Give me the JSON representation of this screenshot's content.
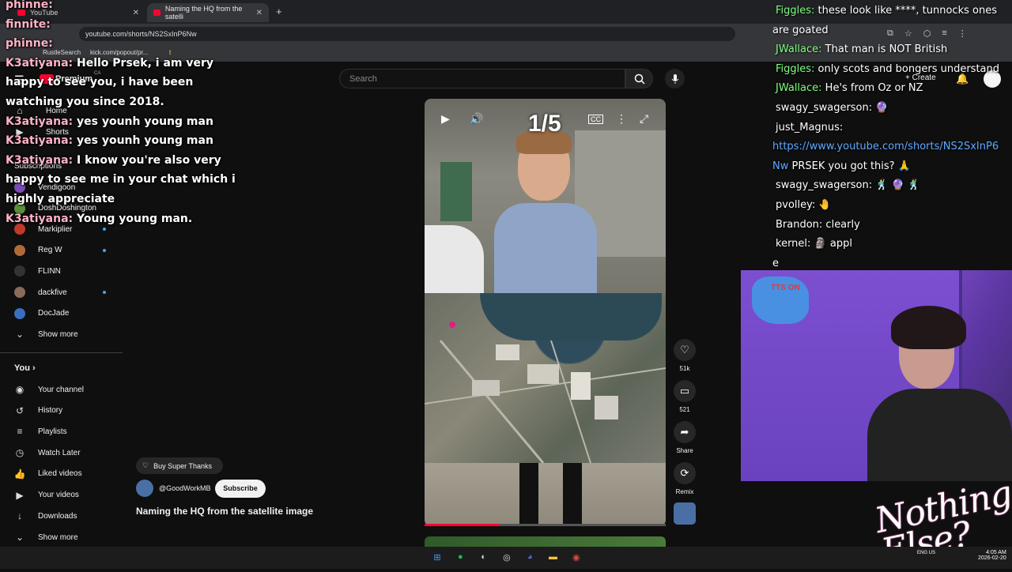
{
  "browser": {
    "tabs": [
      {
        "label": "YouTube"
      },
      {
        "label": "Naming the HQ from the satelli"
      }
    ],
    "new_tab": "+",
    "url": "youtube.com/shorts/NS2SxInP6Nw",
    "bookmarks": [
      "RustleSearch",
      "kick.com/popout/pr...",
      "t"
    ]
  },
  "youtube": {
    "logo": "Premium",
    "region": "CA",
    "search_placeholder": "Search",
    "create_label": "Create",
    "sidebar": {
      "items": [
        {
          "label": "Home",
          "icon": "home-icon"
        },
        {
          "label": "Shorts",
          "icon": "shorts-icon"
        }
      ],
      "subscriptions_title": "Subscriptions",
      "subscriptions": [
        {
          "label": "Vendigoon",
          "color": "#7b4bb8",
          "dot": false
        },
        {
          "label": "DoshDoshington",
          "color": "#5a8f3a",
          "dot": false
        },
        {
          "label": "Markiplier",
          "color": "#c0392b",
          "dot": true
        },
        {
          "label": "Reg W",
          "color": "#b06a3a",
          "dot": true
        },
        {
          "label": "FLINN",
          "color": "#333333",
          "dot": false
        },
        {
          "label": "dackfive",
          "color": "#8a6a5a",
          "dot": true
        },
        {
          "label": "DocJade",
          "color": "#3a6fc0",
          "dot": false
        }
      ],
      "show_more_1": "Show more",
      "you_title": "You",
      "you_items": [
        {
          "label": "Your channel",
          "icon": "channel-icon"
        },
        {
          "label": "History",
          "icon": "history-icon"
        },
        {
          "label": "Playlists",
          "icon": "playlists-icon"
        },
        {
          "label": "Watch Later",
          "icon": "clock-icon"
        },
        {
          "label": "Liked videos",
          "icon": "thumbs-up-icon"
        },
        {
          "label": "Your videos",
          "icon": "video-icon"
        },
        {
          "label": "Downloads",
          "icon": "download-icon"
        }
      ],
      "show_more_2": "Show more"
    },
    "short": {
      "counter": "1/5",
      "progress": 0.32,
      "actions": [
        {
          "label": "51k",
          "icon": "heart-icon"
        },
        {
          "label": "521",
          "icon": "comment-icon"
        },
        {
          "label": "Share",
          "icon": "share-icon"
        },
        {
          "label": "Remix",
          "icon": "remix-icon"
        }
      ],
      "super_thanks": "Buy Super Thanks",
      "channel": "@GoodWorkMB",
      "subscribe": "Subscribe",
      "title": "Naming the HQ from the satellite image"
    }
  },
  "stream_chat_left": [
    {
      "name": "phinne:",
      "text": ""
    },
    {
      "name": "finnite:",
      "text": ""
    },
    {
      "name": "phinne:",
      "text": ""
    },
    {
      "name": "K3atiyana:",
      "text": " Hello Prsek, i am very"
    },
    {
      "name": "",
      "text": "happy to see you, i have been"
    },
    {
      "name": "",
      "text": "watching you since 2018."
    },
    {
      "name": "K3atiyana:",
      "text": " yes younh young man"
    },
    {
      "name": "K3atiyana:",
      "text": " yes younh young man"
    },
    {
      "name": "K3atiyana:",
      "text": " I know you're also very"
    },
    {
      "name": "",
      "text": "happy to see me in your chat which i"
    },
    {
      "name": "",
      "text": "highly appreciate"
    },
    {
      "name": "K3atiyana:",
      "text": " Young young man."
    }
  ],
  "stream_chat_right": [
    {
      "name": "Figgles:",
      "text": " these look like ****, tunnocks ones",
      "color": "#7cff7c"
    },
    {
      "name": "",
      "text": "are goated",
      "color": "#ffffff"
    },
    {
      "name": "JWallace:",
      "text": " That man is NOT British",
      "color": "#7cff7c"
    },
    {
      "name": "Figgles:",
      "text": " only scots and bongers understand",
      "color": "#7cff7c"
    },
    {
      "name": "JWallace:",
      "text": " He's from Oz or NZ",
      "color": "#7cff7c"
    },
    {
      "name": "swagy_swagerson:",
      "text": " 🔮",
      "color": "#ffffff"
    },
    {
      "name": "just_Magnus:",
      "text": "",
      "color": "#ffffff"
    },
    {
      "name": "",
      "text": "https://www.youtube.com/shorts/NS2SxInP6",
      "color": "#ffffff",
      "link": true
    },
    {
      "name": "",
      "text": "Nw",
      "color": "#ffffff",
      "link": true,
      "tail": "  PRSEK you got this? 🙏"
    },
    {
      "name": "swagy_swagerson:",
      "text": " 🕺 🔮 🕺",
      "color": "#ffffff"
    },
    {
      "name": "pvolley:",
      "text": " 🤚",
      "color": "#ffffff"
    },
    {
      "name": "Brandon:",
      "text": " clearly",
      "color": "#ffffff"
    },
    {
      "name": "kernel:",
      "text": " 🗿 appl",
      "color": "#ffffff"
    },
    {
      "name": "",
      "text": "e",
      "color": "#ffffff"
    }
  ],
  "webcam": {
    "sign_text": "TTS ON"
  },
  "overlay_logo": "Nothing Else?",
  "taskbar": {
    "apps": [
      "windows-icon",
      "spotify-icon",
      "steam-icon",
      "obs-icon",
      "discord-icon",
      "folder-icon",
      "chrome-icon"
    ],
    "lang": "ENG US",
    "time": "4:05 AM",
    "date": "2026-02-20"
  }
}
